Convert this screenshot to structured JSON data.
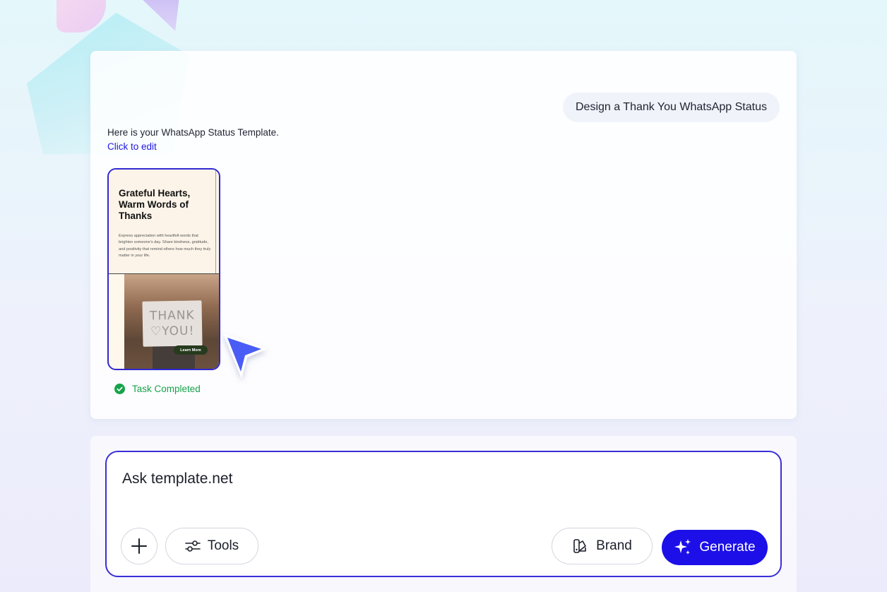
{
  "conversation": {
    "user_message": "Design a Thank You WhatsApp Status",
    "assistant_reply": "Here is your WhatsApp Status Template.",
    "edit_link": "Click to edit",
    "template_preview": {
      "title": "Grateful Hearts, Warm Words of Thanks",
      "description": "Express appreciation with heartfelt words that brighten someone's day. Share kindness, gratitude, and positivity that remind others how much they truly matter in your life.",
      "sign_line1": "THANK",
      "sign_line2": "♡YOU!",
      "button_label": "Learn More"
    },
    "status": "Task Completed"
  },
  "composer": {
    "placeholder": "Ask template.net",
    "tools_label": "Tools",
    "brand_label": "Brand",
    "generate_label": "Generate"
  },
  "colors": {
    "accent": "#1c0fe8",
    "border_accent": "#3a2fd6",
    "success": "#16a34a",
    "link": "#1d17e6"
  }
}
